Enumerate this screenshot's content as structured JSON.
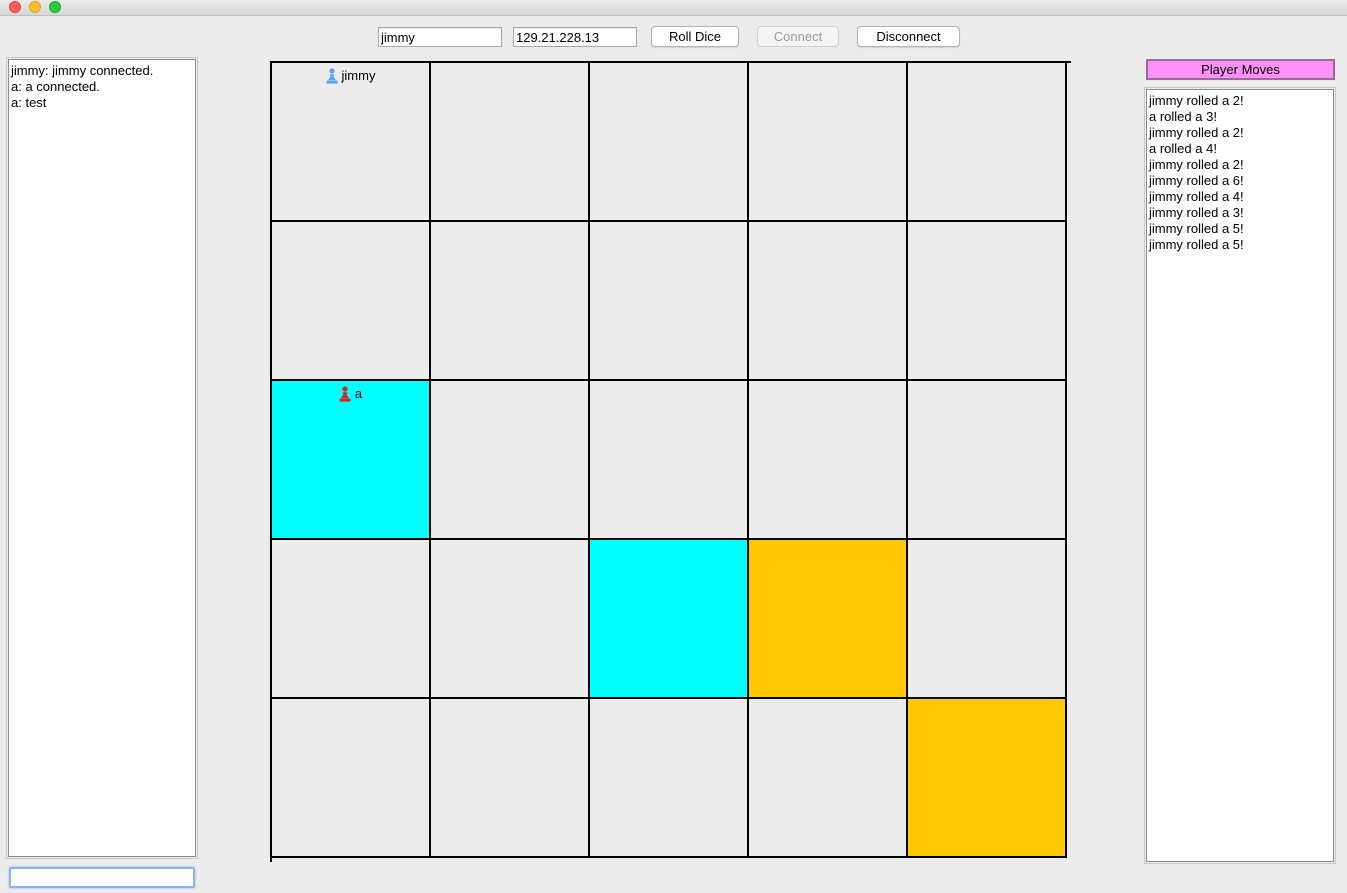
{
  "toolbar": {
    "name_value": "jimmy",
    "ip_value": "129.21.228.13",
    "roll_label": "Roll Dice",
    "connect_label": "Connect",
    "disconnect_label": "Disconnect"
  },
  "chat": {
    "lines": [
      "jimmy: jimmy connected.",
      "a: a connected.",
      "a: test"
    ],
    "input_value": ""
  },
  "moves": {
    "header": "Player Moves",
    "lines": [
      "jimmy rolled a 2!",
      "a rolled a 3!",
      "jimmy rolled a 2!",
      "a rolled a 4!",
      "jimmy rolled a 2!",
      "jimmy rolled a 6!",
      "jimmy rolled a 4!",
      "jimmy rolled a 3!",
      "jimmy rolled a 5!",
      "jimmy rolled a 5!"
    ]
  },
  "board": {
    "rows": 5,
    "cols": 5,
    "colors": {
      "empty": "#ececec",
      "cyan": "#00ffff",
      "gold": "#ffc800"
    },
    "cells": [
      [
        "empty",
        "empty",
        "empty",
        "empty",
        "empty"
      ],
      [
        "empty",
        "empty",
        "empty",
        "empty",
        "empty"
      ],
      [
        "cyan",
        "empty",
        "empty",
        "empty",
        "empty"
      ],
      [
        "empty",
        "empty",
        "cyan",
        "gold",
        "empty"
      ],
      [
        "empty",
        "empty",
        "empty",
        "empty",
        "gold"
      ]
    ],
    "players": [
      {
        "name": "jimmy",
        "row": 0,
        "col": 0,
        "color": "#5aa6ee",
        "icon": "pawn-icon"
      },
      {
        "name": "a",
        "row": 2,
        "col": 0,
        "color": "#e0201c",
        "icon": "pawn-icon"
      }
    ]
  }
}
